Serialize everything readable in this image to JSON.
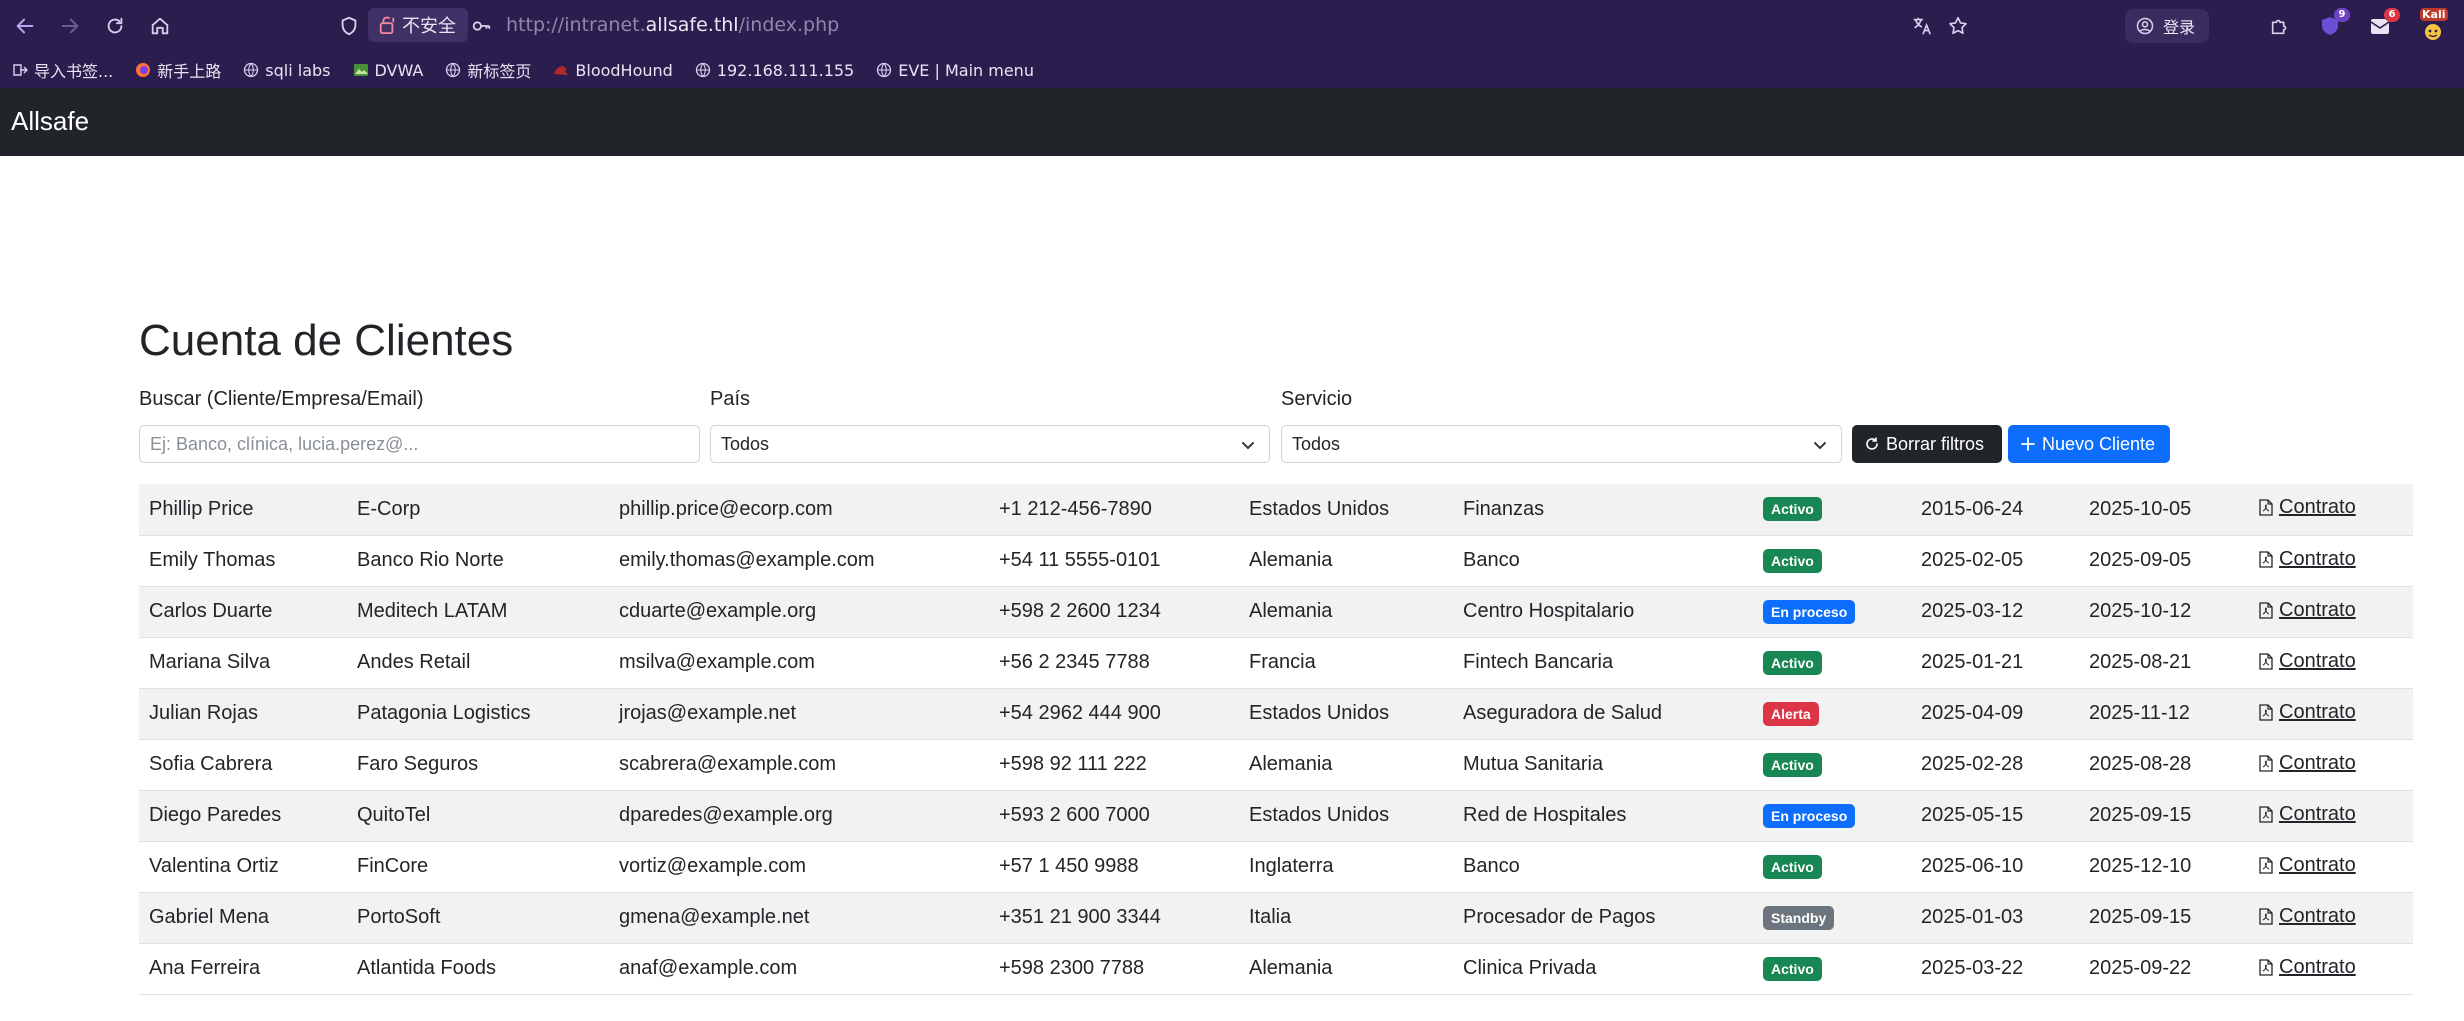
{
  "browser": {
    "insecure_label": "不安全",
    "url_prefix": "http://intranet.",
    "url_host": "allsafe.thl",
    "url_path": "/index.php",
    "login_label": "登录",
    "badge_1": "9",
    "badge_2": "6",
    "profile_label": "Kali",
    "bookmarks": [
      {
        "label": "导入书签...",
        "icon": "import-icon"
      },
      {
        "label": "新手上路",
        "icon": "firefox-icon"
      },
      {
        "label": "sqli labs",
        "icon": "globe-icon"
      },
      {
        "label": "DVWA",
        "icon": "image-icon"
      },
      {
        "label": "新标签页",
        "icon": "globe-icon"
      },
      {
        "label": "BloodHound",
        "icon": "bloodhound-icon"
      },
      {
        "label": "192.168.111.155",
        "icon": "globe-icon"
      },
      {
        "label": "EVE | Main menu",
        "icon": "globe-icon"
      }
    ]
  },
  "app": {
    "brand": "Allsafe",
    "page_title": "Cuenta de Clientes",
    "filters": {
      "search_label": "Buscar (Cliente/Empresa/Email)",
      "search_placeholder": "Ej: Banco, clínica, lucia.perez@...",
      "country_label": "País",
      "country_value": "Todos",
      "service_label": "Servicio",
      "service_value": "Todos",
      "clear_button": "Borrar filtros",
      "new_button": "Nuevo Cliente"
    },
    "status_colors": {
      "Activo": "#198754",
      "En proceso": "#0d6efd",
      "Alerta": "#dc3545",
      "Standby": "#6c757d"
    },
    "clients": [
      {
        "name": "Phillip Price",
        "company": "E-Corp",
        "email": "phillip.price@ecorp.com",
        "phone": "+1 212-456-7890",
        "country": "Estados Unidos",
        "service": "Finanzas",
        "status": "Activo",
        "start": "2015-06-24",
        "end": "2025-10-05",
        "doc": "Contrato"
      },
      {
        "name": "Emily Thomas",
        "company": "Banco Rio Norte",
        "email": "emily.thomas@example.com",
        "phone": "+54 11 5555-0101",
        "country": "Alemania",
        "service": "Banco",
        "status": "Activo",
        "start": "2025-02-05",
        "end": "2025-09-05",
        "doc": "Contrato"
      },
      {
        "name": "Carlos Duarte",
        "company": "Meditech LATAM",
        "email": "cduarte@example.org",
        "phone": "+598 2 2600 1234",
        "country": "Alemania",
        "service": "Centro Hospitalario",
        "status": "En proceso",
        "start": "2025-03-12",
        "end": "2025-10-12",
        "doc": "Contrato"
      },
      {
        "name": "Mariana Silva",
        "company": "Andes Retail",
        "email": "msilva@example.com",
        "phone": "+56 2 2345 7788",
        "country": "Francia",
        "service": "Fintech Bancaria",
        "status": "Activo",
        "start": "2025-01-21",
        "end": "2025-08-21",
        "doc": "Contrato"
      },
      {
        "name": "Julian Rojas",
        "company": "Patagonia Logistics",
        "email": "jrojas@example.net",
        "phone": "+54 2962 444 900",
        "country": "Estados Unidos",
        "service": "Aseguradora de Salud",
        "status": "Alerta",
        "start": "2025-04-09",
        "end": "2025-11-12",
        "doc": "Contrato"
      },
      {
        "name": "Sofia Cabrera",
        "company": "Faro Seguros",
        "email": "scabrera@example.com",
        "phone": "+598 92 111 222",
        "country": "Alemania",
        "service": "Mutua Sanitaria",
        "status": "Activo",
        "start": "2025-02-28",
        "end": "2025-08-28",
        "doc": "Contrato"
      },
      {
        "name": "Diego Paredes",
        "company": "QuitoTel",
        "email": "dparedes@example.org",
        "phone": "+593 2 600 7000",
        "country": "Estados Unidos",
        "service": "Red de Hospitales",
        "status": "En proceso",
        "start": "2025-05-15",
        "end": "2025-09-15",
        "doc": "Contrato"
      },
      {
        "name": "Valentina Ortiz",
        "company": "FinCore",
        "email": "vortiz@example.com",
        "phone": "+57 1 450 9988",
        "country": "Inglaterra",
        "service": "Banco",
        "status": "Activo",
        "start": "2025-06-10",
        "end": "2025-12-10",
        "doc": "Contrato"
      },
      {
        "name": "Gabriel Mena",
        "company": "PortoSoft",
        "email": "gmena@example.net",
        "phone": "+351 21 900 3344",
        "country": "Italia",
        "service": "Procesador de Pagos",
        "status": "Standby",
        "start": "2025-01-03",
        "end": "2025-09-15",
        "doc": "Contrato"
      },
      {
        "name": "Ana Ferreira",
        "company": "Atlantida Foods",
        "email": "anaf@example.com",
        "phone": "+598 2300 7788",
        "country": "Alemania",
        "service": "Clinica Privada",
        "status": "Activo",
        "start": "2025-03-22",
        "end": "2025-09-22",
        "doc": "Contrato"
      }
    ]
  }
}
